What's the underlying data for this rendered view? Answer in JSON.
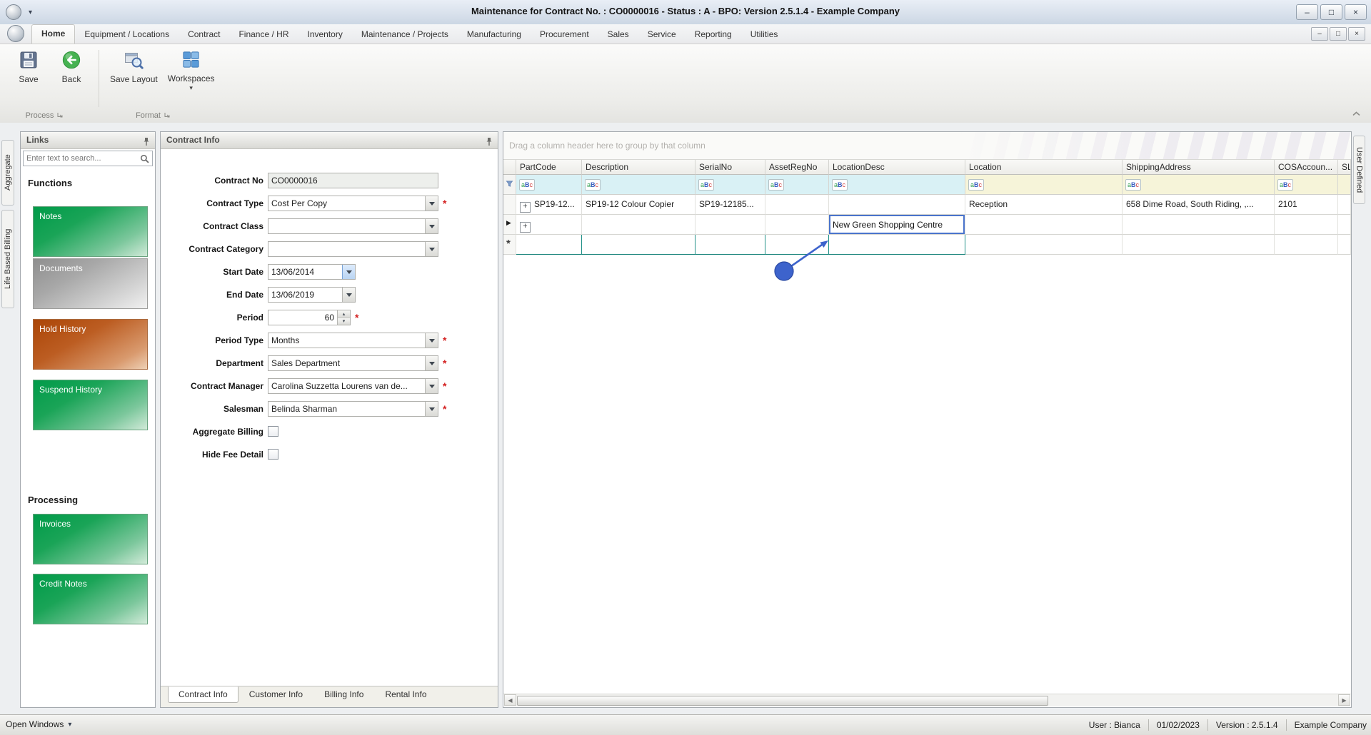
{
  "window": {
    "title": "Maintenance for Contract No. : CO0000016 - Status : A - BPO: Version 2.5.1.4 - Example Company"
  },
  "icons": {
    "caret_down": "▾",
    "minimize": "–",
    "maximize": "□",
    "close": "×",
    "expand_plus": "+",
    "edit_row_marker": "▶",
    "new_row_marker": "*",
    "scroll_left": "◀",
    "scroll_right": "▶",
    "filter_abc": {
      "a": "a",
      "b": "B",
      "c": "c"
    }
  },
  "colors": {
    "annotation_blue": "#3d63cc",
    "new_row_teal": "#2ba19a",
    "link_button_green": "#009b49",
    "link_button_orange": "#ab4506",
    "filter_row_cyan": "#d9f1f5"
  },
  "ribbon": {
    "tabs": [
      {
        "label": "Home"
      },
      {
        "label": "Equipment / Locations"
      },
      {
        "label": "Contract"
      },
      {
        "label": "Finance / HR"
      },
      {
        "label": "Inventory"
      },
      {
        "label": "Maintenance / Projects"
      },
      {
        "label": "Manufacturing"
      },
      {
        "label": "Procurement"
      },
      {
        "label": "Sales"
      },
      {
        "label": "Service"
      },
      {
        "label": "Reporting"
      },
      {
        "label": "Utilities"
      }
    ],
    "buttons": [
      {
        "label": "Save"
      },
      {
        "label": "Back"
      },
      {
        "label": "Save Layout"
      },
      {
        "label": "Workspaces"
      }
    ],
    "groups": [
      {
        "label": "Process"
      },
      {
        "label": "Format"
      }
    ]
  },
  "side_tabs": {
    "left": [
      {
        "label": "Aggregate"
      },
      {
        "label": "Life Based Billing"
      }
    ],
    "right": [
      {
        "label": "User Defined"
      }
    ]
  },
  "links_panel": {
    "title": "Links",
    "search_placeholder": "Enter text to search...",
    "sections": [
      {
        "heading": "Functions",
        "buttons": [
          {
            "label": "Notes",
            "style": "green"
          },
          {
            "label": "Documents",
            "style": "gray"
          },
          {
            "label": "Hold History",
            "style": "orange"
          },
          {
            "label": "Suspend History",
            "style": "green"
          }
        ]
      },
      {
        "heading": "Processing",
        "buttons": [
          {
            "label": "Invoices",
            "style": "green"
          },
          {
            "label": "Credit Notes",
            "style": "green"
          }
        ]
      }
    ]
  },
  "contract_panel": {
    "title": "Contract Info",
    "required_marker": "*",
    "fields": [
      {
        "label": "Contract No",
        "value": "CO0000016",
        "type": "text"
      },
      {
        "label": "Contract Type",
        "value": "Cost Per Copy",
        "type": "combo",
        "required": true
      },
      {
        "label": "Contract Class",
        "value": "",
        "type": "combo"
      },
      {
        "label": "Contract Category",
        "value": "",
        "type": "combo"
      },
      {
        "label": "Start Date",
        "value": "13/06/2014",
        "type": "date"
      },
      {
        "label": "End Date",
        "value": "13/06/2019",
        "type": "date"
      },
      {
        "label": "Period",
        "value": "60",
        "type": "spinner",
        "required": true
      },
      {
        "label": "Period Type",
        "value": "Months",
        "type": "combo",
        "required": true
      },
      {
        "label": "Department",
        "value": "Sales Department",
        "type": "combo",
        "required": true
      },
      {
        "label": "Contract Manager",
        "value": "Carolina Suzzetta Lourens van de...",
        "type": "combo",
        "required": true
      },
      {
        "label": "Salesman",
        "value": "Belinda Sharman",
        "type": "combo",
        "required": true
      },
      {
        "label": "Aggregate Billing",
        "checked": false,
        "type": "checkbox"
      },
      {
        "label": "Hide Fee Detail",
        "checked": false,
        "type": "checkbox"
      }
    ],
    "tabs": [
      {
        "label": "Contract Info",
        "active": true
      },
      {
        "label": "Customer Info"
      },
      {
        "label": "Billing Info"
      },
      {
        "label": "Rental Info"
      }
    ]
  },
  "grid": {
    "group_hint": "Drag a column header here to group by that column",
    "columns": [
      {
        "label": "PartCode"
      },
      {
        "label": "Description"
      },
      {
        "label": "SerialNo"
      },
      {
        "label": "AssetRegNo"
      },
      {
        "label": "LocationDesc"
      },
      {
        "label": "Location"
      },
      {
        "label": "ShippingAddress"
      },
      {
        "label": "COSAccoun..."
      },
      {
        "label": "SL"
      }
    ],
    "rows": [
      {
        "cells": [
          "SP19-12...",
          "SP19-12 Colour Copier",
          "SP19-12185...",
          "",
          "",
          "Reception",
          "658 Dime Road, South Riding, ,...",
          "2101",
          ""
        ]
      },
      {
        "cells": [
          "",
          "",
          "",
          "",
          "New Green Shopping Centre",
          "",
          "",
          "",
          ""
        ],
        "state": "editing"
      },
      {
        "cells": [
          "",
          "",
          "",
          "",
          "",
          "",
          "",
          "",
          ""
        ],
        "state": "new-row"
      }
    ]
  },
  "status_bar": {
    "open_windows": "Open Windows",
    "user": "User : Bianca",
    "date": "01/02/2023",
    "version": "Version : 2.5.1.4",
    "company": "Example Company"
  }
}
